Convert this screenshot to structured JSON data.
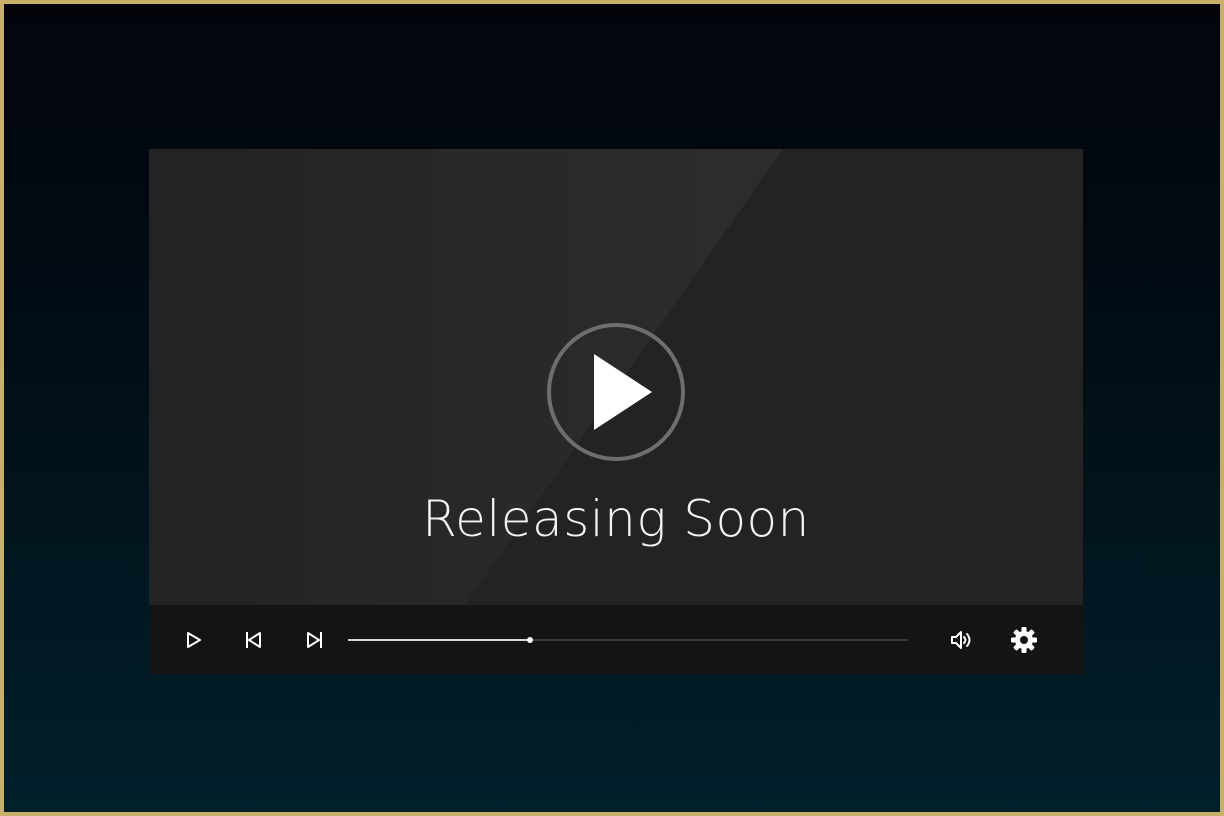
{
  "player": {
    "title": "Releasing Soon",
    "progress_fraction": 0.325
  },
  "controls": {
    "play": "play-icon",
    "previous": "skip-previous-icon",
    "next": "skip-next-icon",
    "volume": "volume-icon",
    "settings": "gear-icon"
  },
  "colors": {
    "frame_border": "#c9b06a",
    "player_bg": "#232323",
    "control_bar_bg": "#141414",
    "text": "#f2f2f2"
  }
}
